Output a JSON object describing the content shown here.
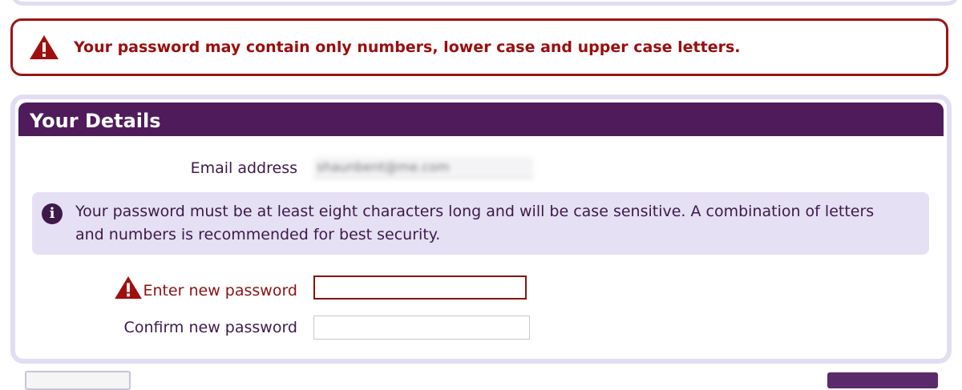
{
  "error": {
    "message": "Your password may contain only numbers, lower case and upper case letters.",
    "icon": "warning-icon",
    "color": "#9b0d0d"
  },
  "details": {
    "title": "Your Details",
    "email_label": "Email address",
    "email_value": "shaunbent@me.com",
    "info_text": "Your password must be at least eight characters long and will be case sensitive. A combination of letters and numbers is recommended for best security.",
    "new_password_label": "Enter new password",
    "new_password_value": "",
    "confirm_password_label": "Confirm new password",
    "confirm_password_value": ""
  },
  "colors": {
    "header": "#4f1b5b",
    "panel_border": "#e2ddf2",
    "error": "#9b1515"
  }
}
